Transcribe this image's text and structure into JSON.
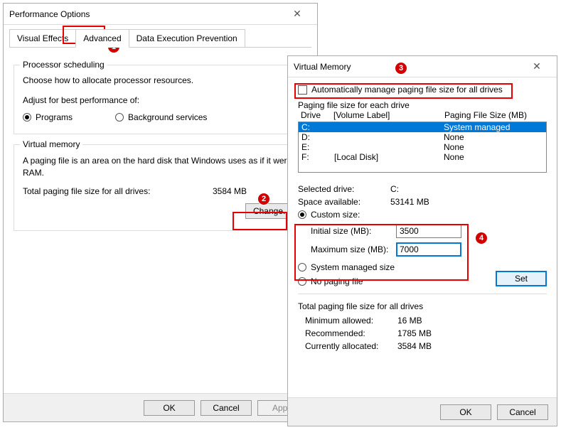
{
  "perf": {
    "title": "Performance Options",
    "tabs": [
      "Visual Effects",
      "Advanced",
      "Data Execution Prevention"
    ],
    "proc": {
      "legend": "Processor scheduling",
      "desc": "Choose how to allocate processor resources.",
      "adjust": "Adjust for best performance of:",
      "opt_programs": "Programs",
      "opt_bg": "Background services"
    },
    "vm": {
      "legend": "Virtual memory",
      "desc": "A paging file is an area on the hard disk that Windows uses as if it were RAM.",
      "total_label": "Total paging file size for all drives:",
      "total_value": "3584 MB",
      "change": "Change..."
    },
    "ok": "OK",
    "cancel": "Cancel",
    "apply": "Apply"
  },
  "vmem": {
    "title": "Virtual Memory",
    "auto_label": "Automatically manage paging file size for all drives",
    "pfs_legend": "Paging file size for each drive",
    "hdr_drive": "Drive",
    "hdr_label": "[Volume Label]",
    "hdr_pfs": "Paging File Size (MB)",
    "drives": [
      {
        "d": "C:",
        "label": "",
        "pfs": "System managed",
        "selected": true
      },
      {
        "d": "D:",
        "label": "",
        "pfs": "None",
        "selected": false
      },
      {
        "d": "E:",
        "label": "",
        "pfs": "None",
        "selected": false
      },
      {
        "d": "F:",
        "label": "[Local Disk]",
        "pfs": "None",
        "selected": false
      }
    ],
    "sel_drive_label": "Selected drive:",
    "sel_drive_value": "C:",
    "space_label": "Space available:",
    "space_value": "53141 MB",
    "custom_label": "Custom size:",
    "initial_label": "Initial size (MB):",
    "initial_value": "3500",
    "max_label": "Maximum size (MB):",
    "max_value": "7000",
    "sysmanaged_label": "System managed size",
    "nopaging_label": "No paging file",
    "set": "Set",
    "total_legend": "Total paging file size for all drives",
    "min_label": "Minimum allowed:",
    "min_value": "16 MB",
    "rec_label": "Recommended:",
    "rec_value": "1785 MB",
    "cur_label": "Currently allocated:",
    "cur_value": "3584 MB",
    "ok": "OK",
    "cancel": "Cancel"
  },
  "badges": {
    "b1": "1",
    "b2": "2",
    "b3": "3",
    "b4": "4"
  }
}
